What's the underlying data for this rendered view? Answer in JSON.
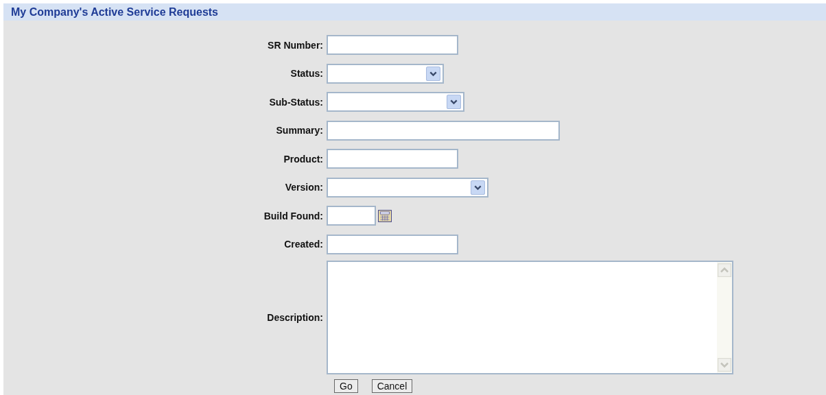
{
  "header": {
    "title": "My Company's Active Service Requests"
  },
  "fields": [
    {
      "label": "SR Number:",
      "kind": "text"
    },
    {
      "label": "Status:",
      "kind": "select"
    },
    {
      "label": "Sub-Status:",
      "kind": "select"
    },
    {
      "label": "Summary:",
      "kind": "text"
    },
    {
      "label": "Product:",
      "kind": "text"
    },
    {
      "label": "Version:",
      "kind": "select"
    },
    {
      "label": "Build Found:",
      "kind": "date"
    },
    {
      "label": "Created:",
      "kind": "text"
    },
    {
      "label": "Description:",
      "kind": "textarea"
    }
  ],
  "buttons": [
    "Go",
    "Cancel"
  ]
}
